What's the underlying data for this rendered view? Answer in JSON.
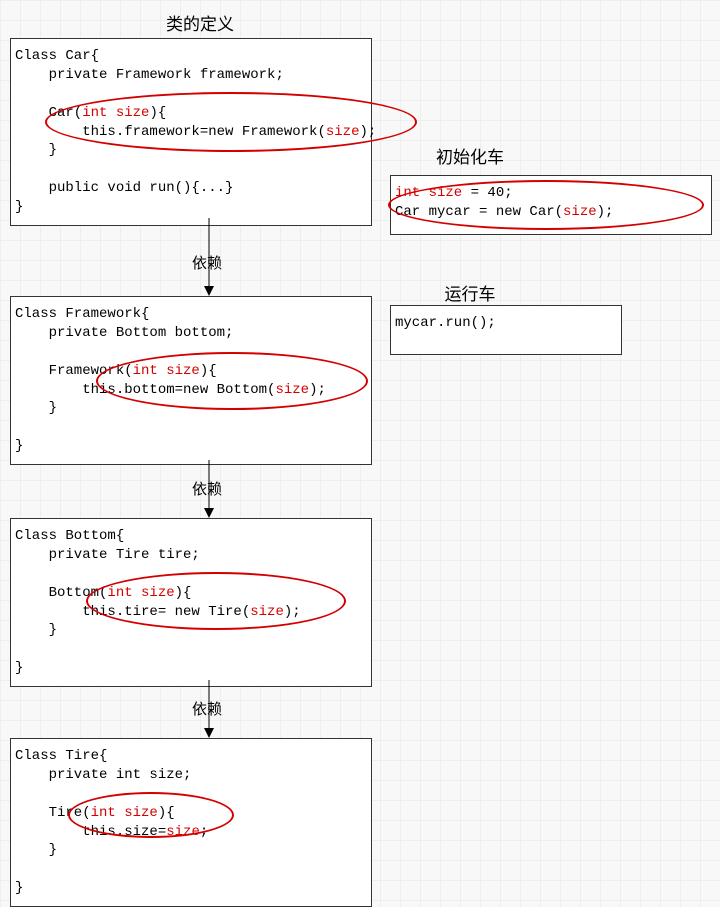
{
  "headings": {
    "class_def": "类的定义",
    "init_car": "初始化车",
    "run_car": "运行车"
  },
  "arrows": {
    "depend": "依赖"
  },
  "code": {
    "car": {
      "l1": "Class Car{",
      "l2": "    private Framework framework;",
      "l3": "",
      "l4a": "    Car(",
      "l4b": "int size",
      "l4c": "){",
      "l5a": "        this.framework=new Framework(",
      "l5b": "size",
      "l5c": ");",
      "l6": "    }",
      "l7": "",
      "l8": "    public void run(){...}",
      "l9": "}"
    },
    "framework": {
      "l1": "Class Framework{",
      "l2": "    private Bottom bottom;",
      "l3": "",
      "l4a": "    Framework(",
      "l4b": "int size",
      "l4c": "){",
      "l5a": "        this.bottom=new Bottom(",
      "l5b": "size",
      "l5c": ");",
      "l6": "    }",
      "l7": "",
      "l8": "}"
    },
    "bottom": {
      "l1": "Class Bottom{",
      "l2": "    private Tire tire;",
      "l3": "",
      "l4a": "    Bottom(",
      "l4b": "int size",
      "l4c": "){",
      "l5a": "        this.tire= new Tire(",
      "l5b": "size",
      "l5c": ");",
      "l6": "    }",
      "l7": "",
      "l8": "}"
    },
    "tire": {
      "l1": "Class Tire{",
      "l2": "    private int size;",
      "l3": "",
      "l4a": "    Tire(",
      "l4b": "int size",
      "l4c": "){",
      "l5a": "        this.size=",
      "l5b": "size",
      "l5c": ";",
      "l6": "    }",
      "l7": "",
      "l8": "}"
    },
    "init": {
      "l1a": "int size",
      "l1b": " = 40;",
      "l2a": "Car mycar = new Car(",
      "l2b": "size",
      "l2c": ");"
    },
    "run": {
      "l1": "mycar.run();"
    }
  }
}
